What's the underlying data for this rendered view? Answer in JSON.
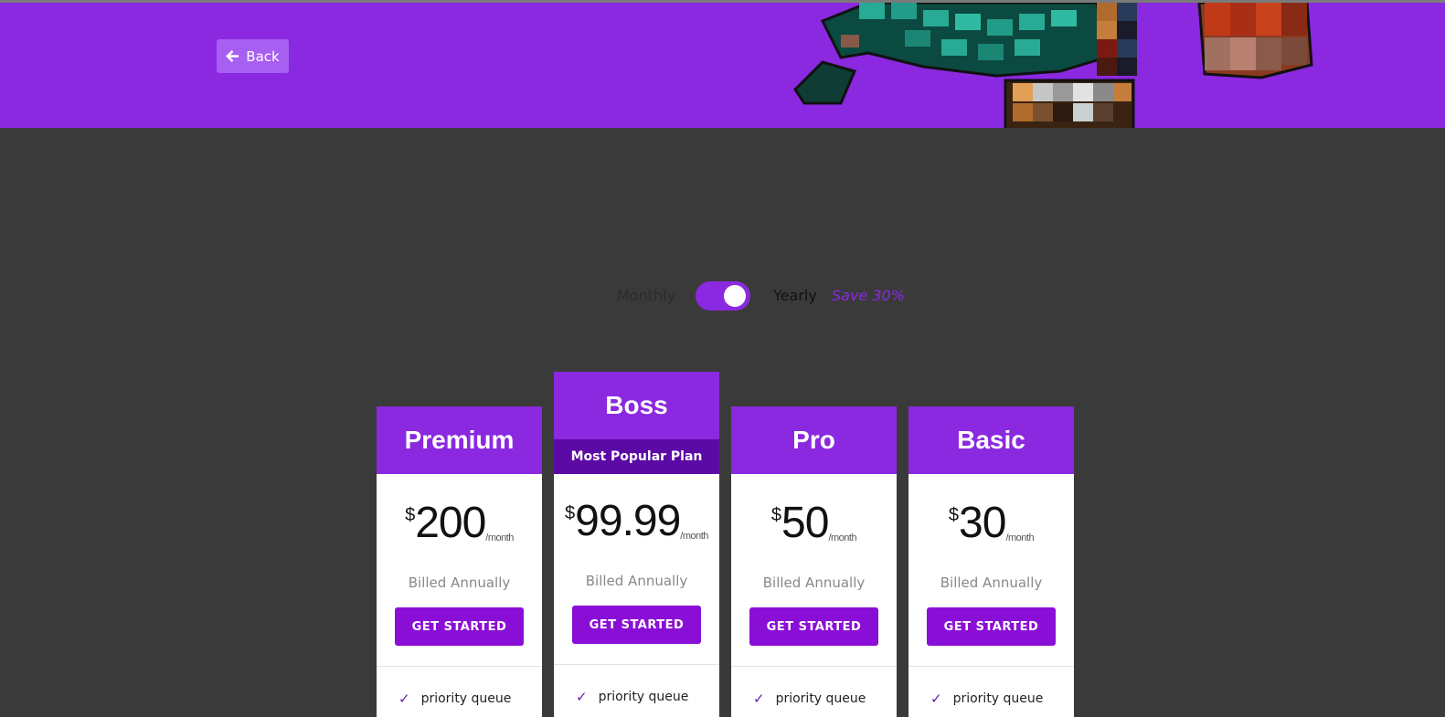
{
  "header": {
    "back_label": "Back"
  },
  "billing": {
    "monthly_label": "Monthly",
    "yearly_label": "Yearly",
    "save_label": "Save 30%",
    "selected": "yearly"
  },
  "plans": [
    {
      "name": "Premium",
      "currency": "$",
      "price": "200",
      "period": "/month",
      "billed": "Billed Annually",
      "cta": "GET STARTED",
      "features": [
        "priority queue"
      ]
    },
    {
      "name": "Boss",
      "badge": "Most Popular Plan",
      "currency": "$",
      "price": "99.99",
      "period": "/month",
      "billed": "Billed Annually",
      "cta": "GET STARTED",
      "features": [
        "priority queue"
      ]
    },
    {
      "name": "Pro",
      "currency": "$",
      "price": "50",
      "period": "/month",
      "billed": "Billed Annually",
      "cta": "GET STARTED",
      "features": [
        "priority queue"
      ]
    },
    {
      "name": "Basic",
      "currency": "$",
      "price": "30",
      "period": "/month",
      "billed": "Billed Annually",
      "cta": "GET STARTED",
      "features": [
        "priority queue"
      ]
    }
  ],
  "icons": {
    "back": "arrow-left-icon",
    "feature": "check-icon"
  },
  "colors": {
    "accent": "#8a29e0",
    "accent_dark": "#5c0aa6",
    "background": "#3a3a3b",
    "button": "#8a0fd6"
  }
}
